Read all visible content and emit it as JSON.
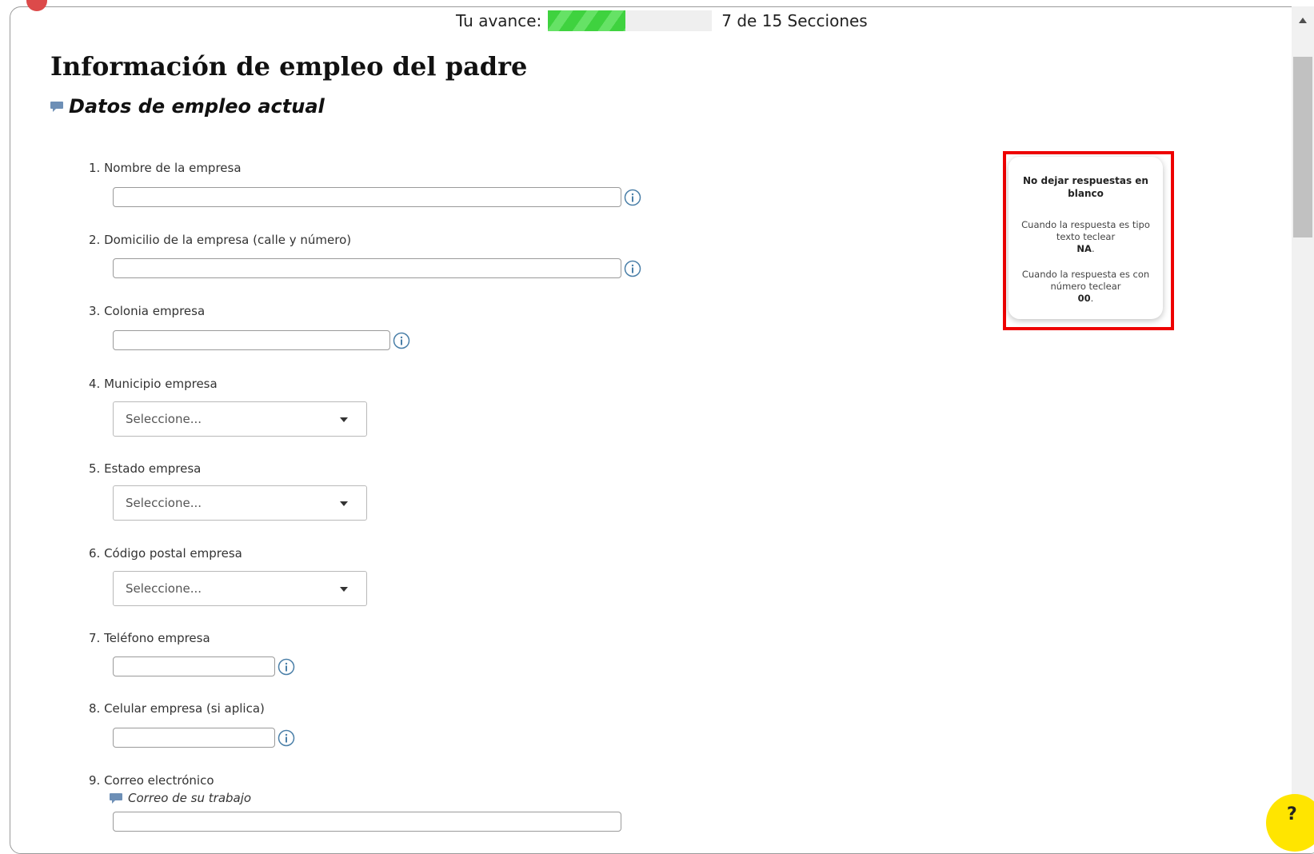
{
  "progress": {
    "label": "Tu avance:",
    "fraction": 0.47,
    "text": "7 de 15 Secciones"
  },
  "page": {
    "title": "Información de empleo del padre",
    "subtitle": "Datos de empleo actual"
  },
  "fields": {
    "f1": {
      "label": "1. Nombre de la empresa"
    },
    "f2": {
      "label": "2. Domicilio de la empresa (calle y número)"
    },
    "f3": {
      "label": "3. Colonia empresa"
    },
    "f4": {
      "label": "4. Municipio empresa",
      "selected": "Seleccione..."
    },
    "f5": {
      "label": "5. Estado empresa",
      "selected": "Seleccione..."
    },
    "f6": {
      "label": "6. Código postal empresa",
      "selected": "Seleccione..."
    },
    "f7": {
      "label": "7. Teléfono empresa"
    },
    "f8": {
      "label": "8. Celular empresa (si aplica)"
    },
    "f9": {
      "label": "9. Correo electrónico",
      "hint": "Correo de su trabajo"
    }
  },
  "notice": {
    "title": "No dejar respuestas en blanco",
    "text_rule": "Cuando la respuesta es tipo texto teclear",
    "text_value": "NA",
    "number_rule": "Cuando la respuesta es con número teclear",
    "number_value": "00",
    "period": "."
  },
  "colors": {
    "progress_green": "#3fd23f",
    "highlight_red": "#ee0000",
    "help_yellow": "#ffe500",
    "info_blue": "#4a7fa8"
  },
  "icons": {
    "info": "info-circle-icon",
    "comment": "speech-bubble-icon",
    "dropdown": "caret-down-icon",
    "help": "help-icon"
  }
}
